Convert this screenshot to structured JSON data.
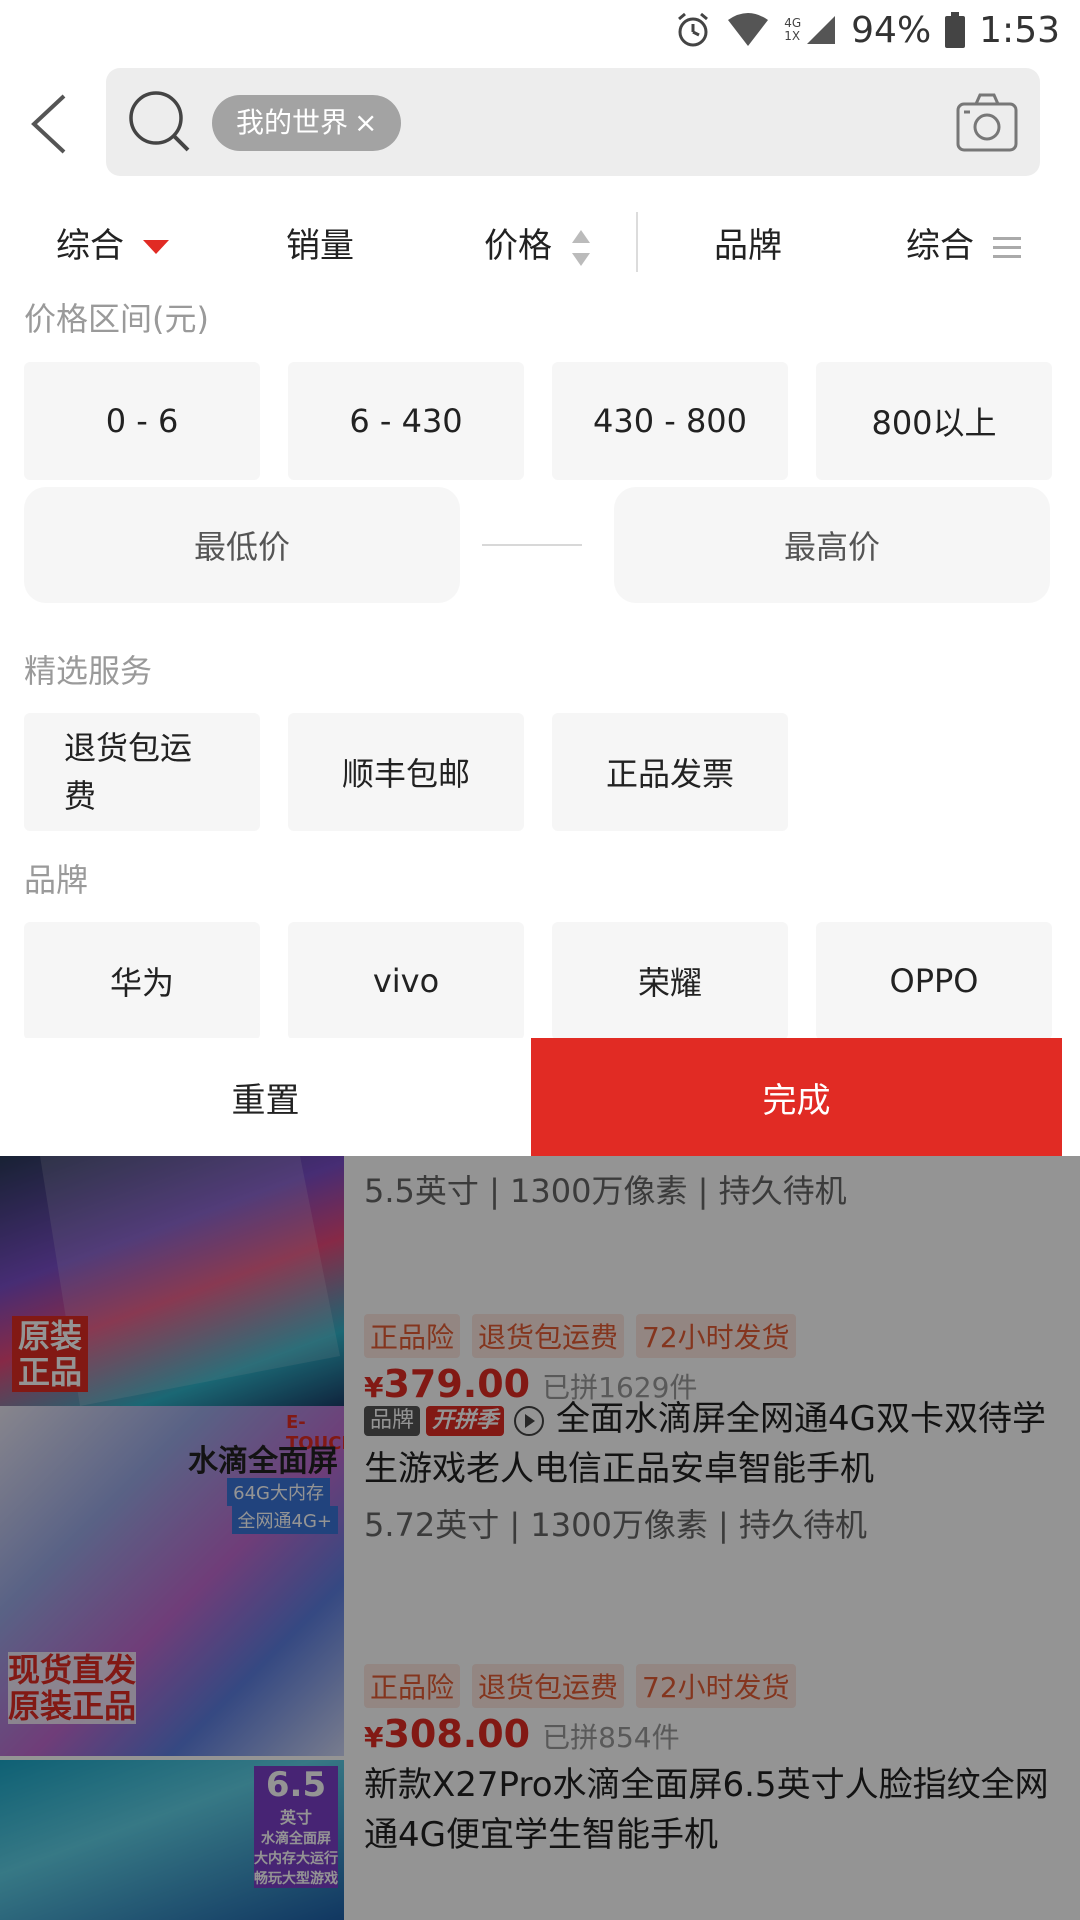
{
  "status_bar": {
    "battery": "94%",
    "time": "1:53",
    "net_top": "4G",
    "net_bottom": "1X",
    "icons": [
      "alarm-icon",
      "wifi-icon",
      "signal-icon",
      "battery-icon"
    ]
  },
  "search": {
    "chip_label": "我的世界",
    "chip_close": "×"
  },
  "sort_tabs": [
    {
      "label": "综合",
      "icon": "triangle-down-icon",
      "active": true
    },
    {
      "label": "销量"
    },
    {
      "label": "价格",
      "icon": "sort-updown-icon"
    },
    {
      "label": "品牌"
    },
    {
      "label": "综合",
      "icon": "menu-lines-icon"
    }
  ],
  "filter": {
    "price_section": "价格区间(元)",
    "price_ranges": [
      "0 - 6",
      "6 - 430",
      "430 - 800",
      "800以上"
    ],
    "min_placeholder": "最低价",
    "max_placeholder": "最高价",
    "service_section": "精选服务",
    "services": [
      "退货包运费",
      "顺丰包邮",
      "正品发票"
    ],
    "brand_section": "品牌",
    "brands": [
      "华为",
      "vivo",
      "荣耀",
      "OPPO"
    ],
    "reset_label": "重置",
    "done_label": "完成"
  },
  "products": [
    {
      "specs": "5.5英寸 | 1300万像素 | 持久待机"
    },
    {
      "tags": [
        "正品险",
        "退货包运费",
        "72小时发货"
      ],
      "currency": "¥",
      "price": "379.00",
      "sold": "已拼1629件",
      "brand_badge": "品牌",
      "pin_badge": "开拼季",
      "title": "全面水滴屏全网通4G双卡双待学生游戏老人电信正品安卓智能手机",
      "specs": "5.72英寸 | 1300万像素 | 持久待机",
      "image_texts": [
        "原装",
        "正品",
        "E-TOUCH",
        "水滴全面屏",
        "64G大内存",
        "全网通4G+",
        "现货直发",
        "原装正品"
      ]
    },
    {
      "tags": [
        "正品险",
        "退货包运费",
        "72小时发货"
      ],
      "currency": "¥",
      "price": "308.00",
      "sold": "已拼854件",
      "title": "新款X27Pro水滴全面屏6.5英寸人脸指纹全网通4G便宜学生智能手机",
      "image_texts": [
        "6.5",
        "英寸",
        "水滴全面屏",
        "大内存大运行",
        "畅玩大型游戏"
      ]
    }
  ],
  "colors": {
    "accent": "#e12b24",
    "chip_bg": "#a3a3a3",
    "option_bg": "#f6f6f6",
    "tag_text": "#e35c34"
  }
}
